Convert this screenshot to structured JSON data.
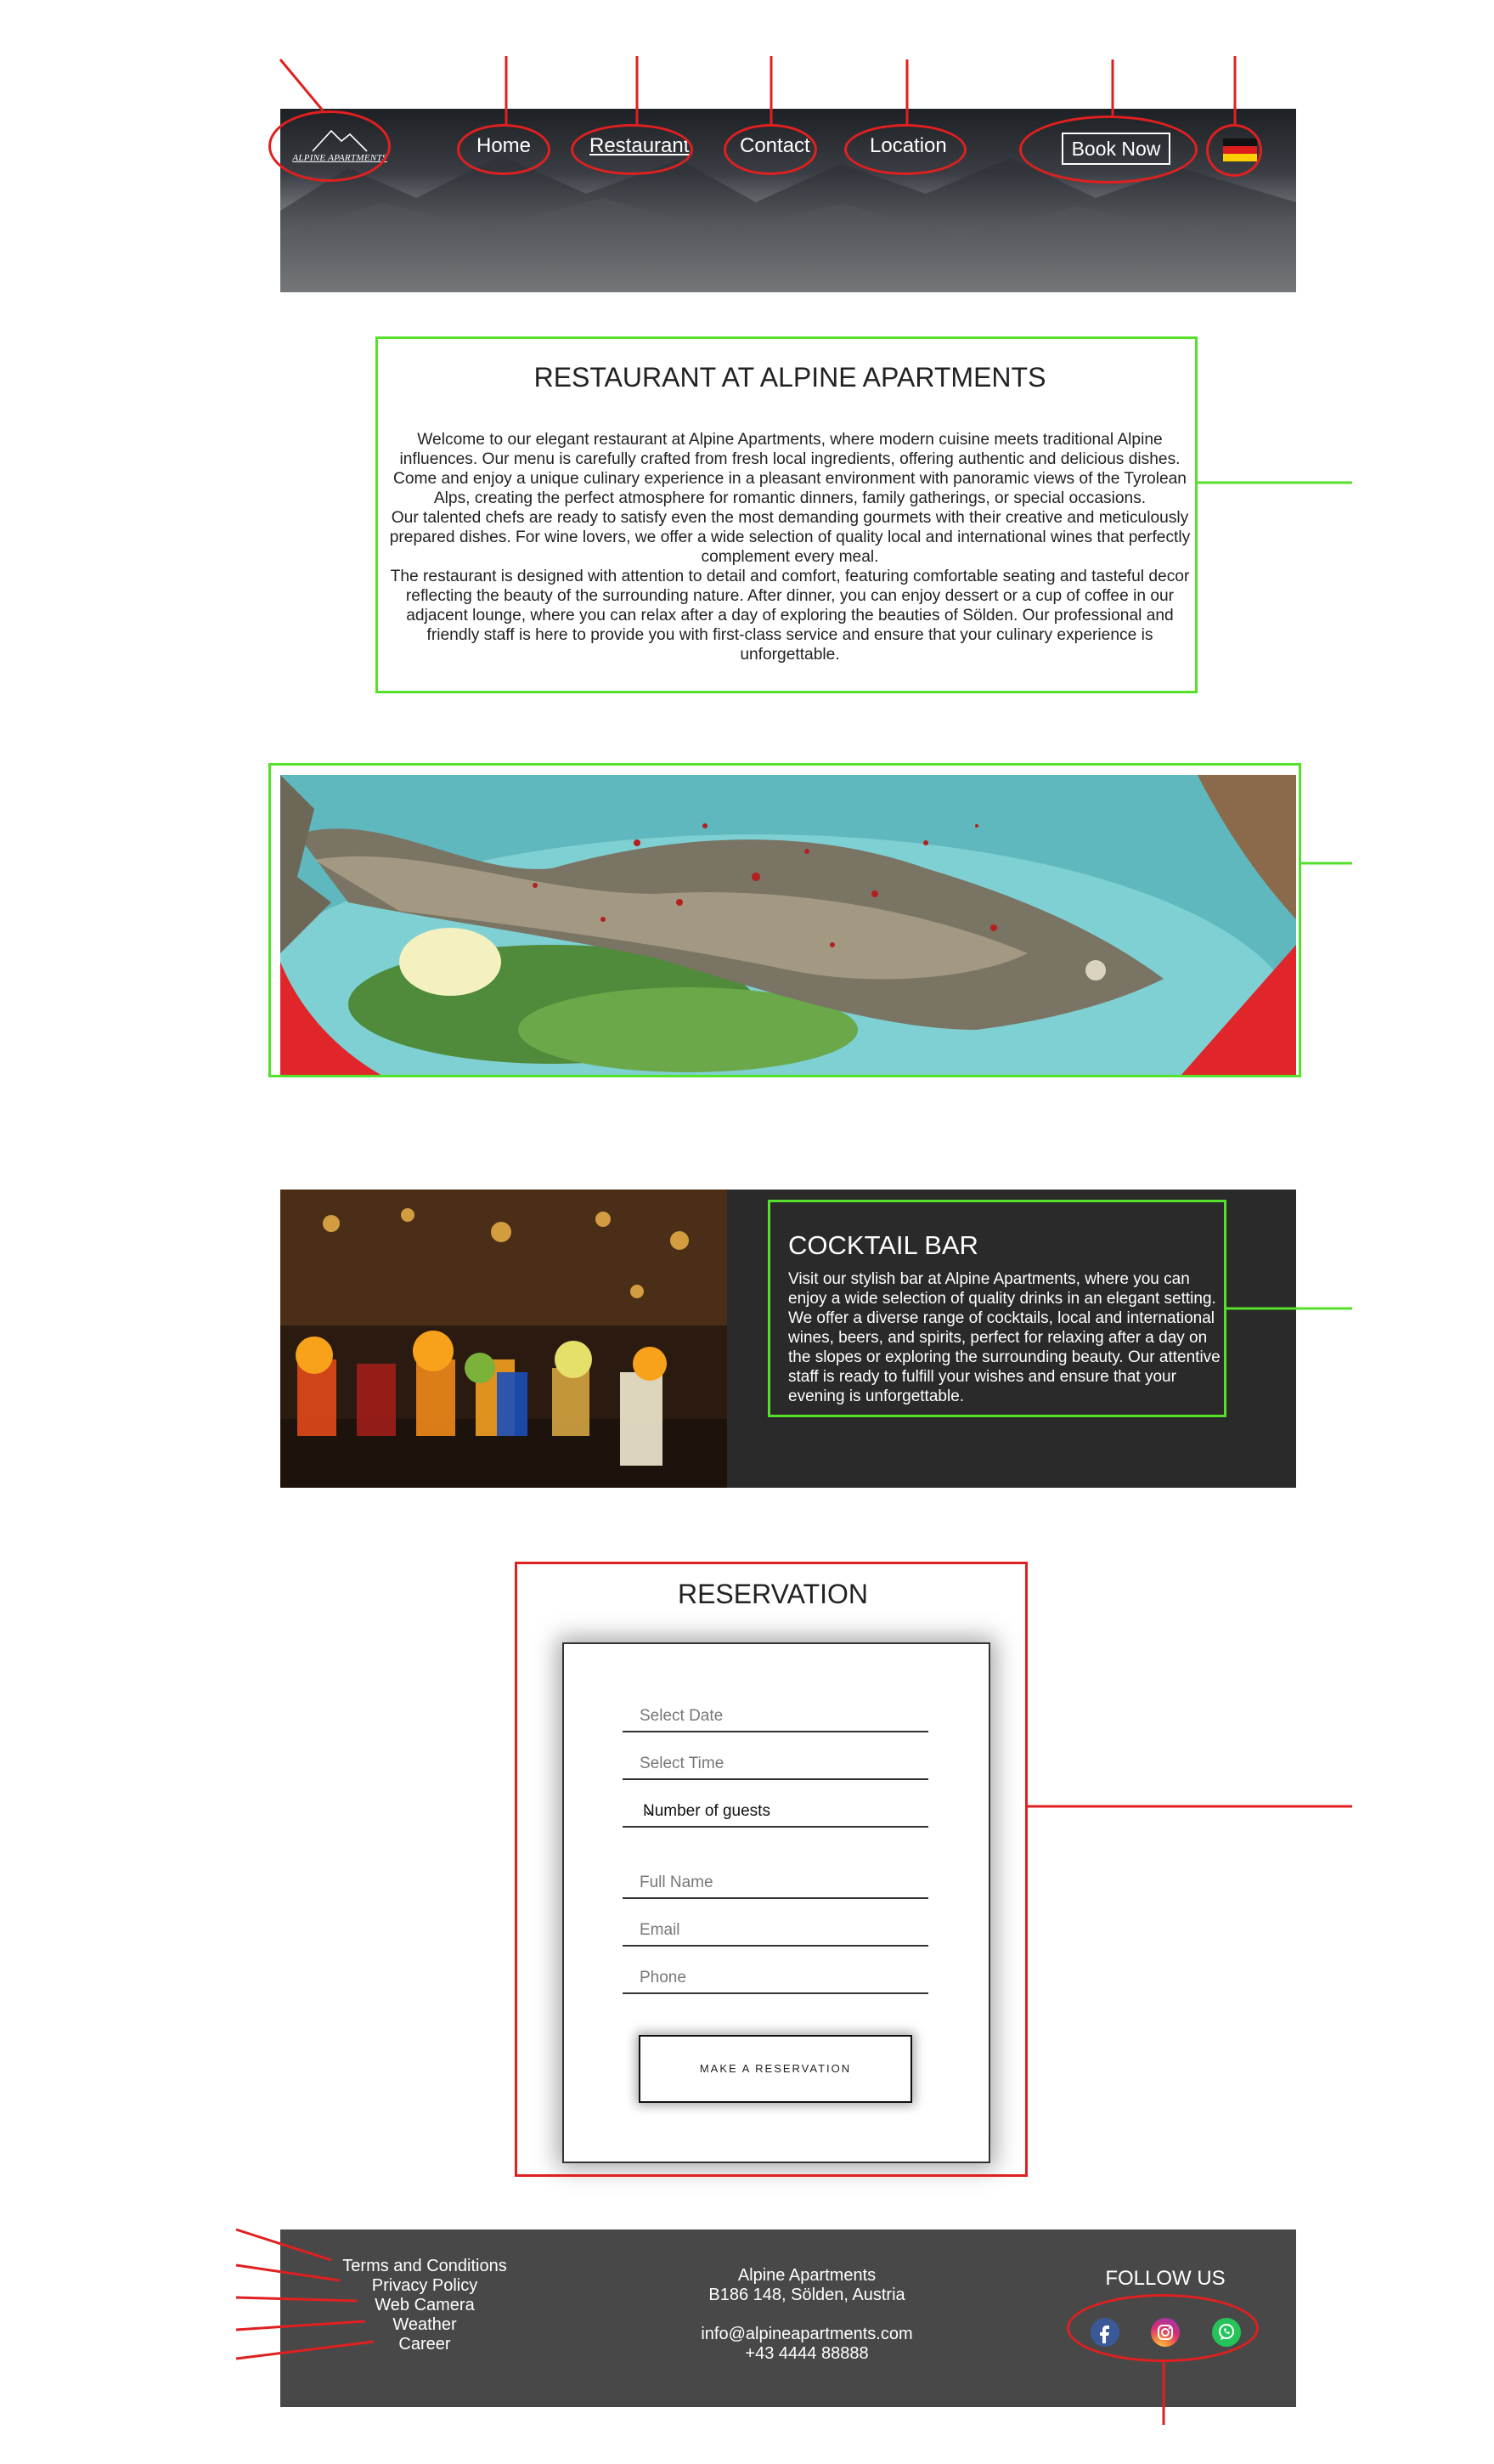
{
  "header": {
    "logo_text": "ALPINE APARTMENTS",
    "nav": [
      "Home",
      "Restaurant",
      "Contact",
      "Location"
    ],
    "book_now": "Book Now",
    "language_flag": "german-flag-icon"
  },
  "intro": {
    "title": "RESTAURANT AT ALPINE APARTMENTS",
    "paragraphs": [
      "Welcome to our elegant restaurant at Alpine Apartments, where modern cuisine meets traditional Alpine influences. Our menu is carefully crafted from fresh local ingredients, offering authentic and delicious dishes. Come and enjoy a unique culinary experience in a pleasant environment with panoramic views of the Tyrolean Alps, creating the perfect atmosphere for romantic dinners, family gatherings, or special occasions.",
      "Our talented chefs are ready to satisfy even the most demanding gourmets with their creative and meticulously prepared dishes. For wine lovers, we offer a wide selection of quality local and international wines that perfectly complement every meal.",
      "The restaurant is designed with attention to detail and comfort, featuring comfortable seating and tasteful decor reflecting the beauty of the surrounding nature. After dinner, you can enjoy dessert or a cup of coffee in our adjacent lounge, where you can relax after a day of exploring the beauties of Sölden. Our professional and friendly staff is here to provide you with first-class service and ensure that your culinary experience is unforgettable."
    ]
  },
  "cocktail_bar": {
    "title": "COCKTAIL BAR",
    "text": "Visit our stylish bar at Alpine Apartments, where you can enjoy a wide selection of quality drinks in an elegant setting. We offer a diverse range of cocktails, local and international wines, beers, and spirits, perfect for relaxing after a day on the slopes or exploring the surrounding beauty. Our attentive staff is ready to fulfill your wishes and ensure that your evening is unforgettable."
  },
  "reservation": {
    "title": "RESERVATION",
    "date_placeholder": "Select Date",
    "time_placeholder": "Select Time",
    "guests_selected": "Number of guests",
    "name_placeholder": "Full Name",
    "email_placeholder": "Email",
    "phone_placeholder": "Phone",
    "button": "MAKE A RESERVATION"
  },
  "footer": {
    "links": [
      "Terms and Conditions",
      "Privacy Policy",
      "Web Camera",
      "Weather",
      "Career"
    ],
    "company": "Alpine Apartments",
    "address": "B186 148, Sölden, Austria",
    "email": "info@alpineapartments.com",
    "phone": "+43 4444 88888",
    "follow": "FOLLOW US",
    "social": [
      "facebook-icon",
      "instagram-icon",
      "whatsapp-icon"
    ]
  },
  "colors": {
    "annotation_red": "#e02020",
    "annotation_green": "#55e02a",
    "cocktail_bg": "#2a2a2a",
    "footer_bg": "#484848"
  }
}
